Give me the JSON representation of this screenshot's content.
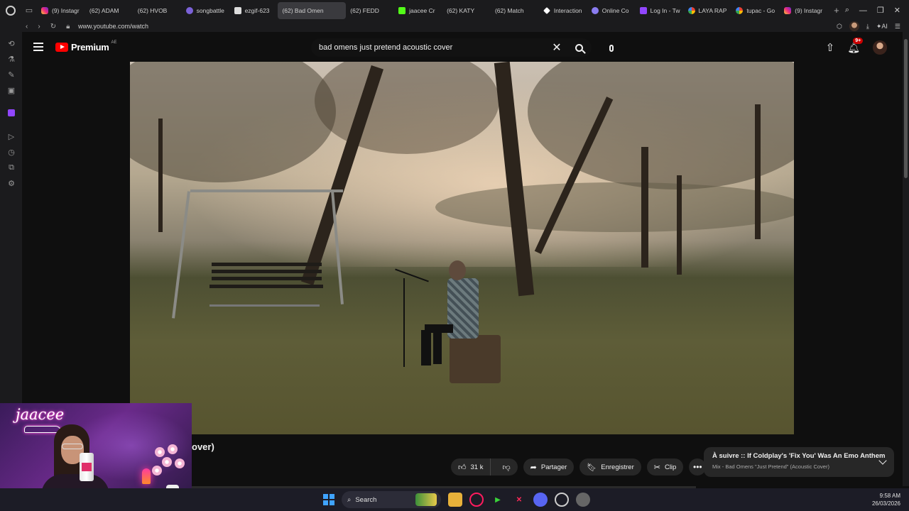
{
  "browser": {
    "tabs": [
      {
        "label": "(9) Instagr",
        "favicon": "instagram-icon",
        "active": false
      },
      {
        "label": "(62) ADAM",
        "favicon": "youtube-icon",
        "active": false
      },
      {
        "label": "(62) HVOB",
        "favicon": "youtube-icon",
        "active": false
      },
      {
        "label": "songbattle",
        "favicon": "x-icon",
        "active": false
      },
      {
        "label": "ezgif-623",
        "favicon": "document-icon",
        "active": false
      },
      {
        "label": "(62) Bad Omen",
        "favicon": "youtube-icon",
        "active": true
      },
      {
        "label": "(62) FEDD",
        "favicon": "youtube-icon",
        "active": false
      },
      {
        "label": "jaacee Cr",
        "favicon": "kick-icon",
        "active": false
      },
      {
        "label": "(62) KATY",
        "favicon": "youtube-icon",
        "active": false
      },
      {
        "label": "(62) Match",
        "favicon": "youtube-icon",
        "active": false
      },
      {
        "label": "Interaction",
        "favicon": "diamond-icon",
        "active": false
      },
      {
        "label": "Online Co",
        "favicon": "circle-icon",
        "active": false
      },
      {
        "label": "Log In - Tw",
        "favicon": "twitch-icon",
        "active": false
      },
      {
        "label": "LAYA RAP",
        "favicon": "google-icon",
        "active": false
      },
      {
        "label": "tupac - Go",
        "favicon": "google-icon",
        "active": false
      },
      {
        "label": "(9) Instagr",
        "favicon": "instagram-icon",
        "active": false
      }
    ],
    "url": "www.youtube.com/watch",
    "ai_label": "AI"
  },
  "youtube": {
    "logo_text": "Premium",
    "logo_region": "AE",
    "search_query": "bad omens just pretend acoustic cover",
    "notification_badge": "9+",
    "video_title_visible": "over)",
    "actions": {
      "like_count": "31 k",
      "share_label": "Partager",
      "save_label": "Enregistrer",
      "clip_label": "Clip"
    },
    "up_next": {
      "prefix": "À suivre :",
      "title": ": If Coldplay's 'Fix You' Was An Emo Anthem",
      "subtitle": "Mix - Bad Omens \"Just Pretend\" (Acoustic Cover)"
    }
  },
  "webcam": {
    "overlay_name": "jaacee"
  },
  "taskbar": {
    "search_label": "Search",
    "time": "9:58 AM",
    "date": "26/03/2026"
  },
  "colors": {
    "yt_red": "#ff0000",
    "background": "#0f0f0f",
    "pill": "#272727",
    "neon_pink": "#ff4fd8"
  }
}
